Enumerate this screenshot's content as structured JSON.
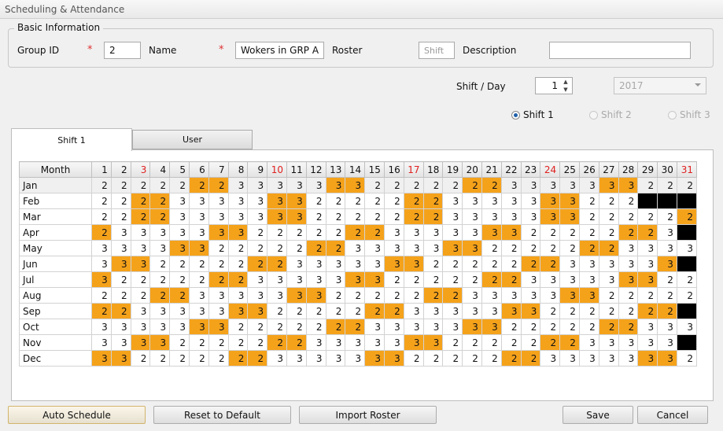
{
  "window": {
    "title": "Scheduling & Attendance"
  },
  "basic_info": {
    "legend": "Basic Information",
    "group_id_label": "Group ID",
    "required_mark": "*",
    "group_id_value": "2",
    "name_label": "Name",
    "name_value": "Wokers in GRP A",
    "roster_label": "Roster",
    "roster_placeholder": "Shift",
    "description_label": "Description",
    "description_value": ""
  },
  "shift_day": {
    "label": "Shift / Day",
    "value": "1",
    "year": "2017"
  },
  "shift_radios": [
    {
      "label": "Shift 1",
      "selected": true
    },
    {
      "label": "Shift 2",
      "selected": false
    },
    {
      "label": "Shift 3",
      "selected": false
    }
  ],
  "tabs": [
    {
      "label": "Shift 1"
    },
    {
      "label": "User"
    }
  ],
  "grid": {
    "month_header": "Month",
    "days": [
      "1",
      "2",
      "3",
      "4",
      "5",
      "6",
      "7",
      "8",
      "9",
      "10",
      "11",
      "12",
      "13",
      "14",
      "15",
      "16",
      "17",
      "18",
      "19",
      "20",
      "21",
      "22",
      "23",
      "24",
      "25",
      "26",
      "27",
      "28",
      "29",
      "30",
      "31"
    ],
    "red_days": [
      3,
      10,
      17,
      24,
      31
    ],
    "colors": {
      "highlight": "#f5a21b",
      "unavailable": "#000000"
    },
    "rows": [
      {
        "month": "Jan",
        "values": [
          "2",
          "2",
          "2",
          "2",
          "2",
          "2",
          "2",
          "3",
          "3",
          "3",
          "3",
          "3",
          "3",
          "3",
          "2",
          "2",
          "2",
          "2",
          "2",
          "2",
          "2",
          "3",
          "3",
          "3",
          "3",
          "3",
          "3",
          "3",
          "2",
          "2",
          "2"
        ],
        "highlight": [
          6,
          7,
          13,
          14,
          20,
          21,
          27,
          28
        ]
      },
      {
        "month": "Feb",
        "values": [
          "2",
          "2",
          "2",
          "2",
          "3",
          "3",
          "3",
          "3",
          "3",
          "3",
          "3",
          "2",
          "2",
          "2",
          "2",
          "2",
          "2",
          "2",
          "3",
          "3",
          "3",
          "3",
          "3",
          "3",
          "3",
          "2",
          "2",
          "2",
          "",
          "",
          ""
        ],
        "highlight": [
          3,
          4,
          10,
          11,
          17,
          18,
          24,
          25
        ],
        "blocked": [
          29,
          30,
          31
        ]
      },
      {
        "month": "Mar",
        "values": [
          "2",
          "2",
          "2",
          "2",
          "3",
          "3",
          "3",
          "3",
          "3",
          "3",
          "3",
          "2",
          "2",
          "2",
          "2",
          "2",
          "2",
          "2",
          "3",
          "3",
          "3",
          "3",
          "3",
          "3",
          "3",
          "2",
          "2",
          "2",
          "2",
          "2",
          "2"
        ],
        "highlight": [
          3,
          4,
          10,
          11,
          17,
          18,
          24,
          25,
          31
        ]
      },
      {
        "month": "Apr",
        "values": [
          "2",
          "3",
          "3",
          "3",
          "3",
          "3",
          "3",
          "3",
          "2",
          "2",
          "2",
          "2",
          "2",
          "2",
          "2",
          "3",
          "3",
          "3",
          "3",
          "3",
          "3",
          "3",
          "2",
          "2",
          "2",
          "2",
          "2",
          "2",
          "2",
          "3",
          ""
        ],
        "highlight": [
          1,
          7,
          8,
          14,
          15,
          21,
          22,
          28,
          29
        ],
        "blocked": [
          31
        ]
      },
      {
        "month": "May",
        "values": [
          "3",
          "3",
          "3",
          "3",
          "3",
          "3",
          "2",
          "2",
          "2",
          "2",
          "2",
          "2",
          "2",
          "3",
          "3",
          "3",
          "3",
          "3",
          "3",
          "3",
          "2",
          "2",
          "2",
          "2",
          "2",
          "2",
          "2",
          "3",
          "3",
          "3",
          "3"
        ],
        "highlight": [
          5,
          6,
          12,
          13,
          19,
          20,
          26,
          27
        ]
      },
      {
        "month": "Jun",
        "values": [
          "3",
          "3",
          "3",
          "2",
          "2",
          "2",
          "2",
          "2",
          "2",
          "2",
          "3",
          "3",
          "3",
          "3",
          "3",
          "3",
          "3",
          "2",
          "2",
          "2",
          "2",
          "2",
          "2",
          "2",
          "3",
          "3",
          "3",
          "3",
          "3",
          "3",
          ""
        ],
        "highlight": [
          2,
          3,
          9,
          10,
          16,
          17,
          23,
          24,
          30
        ],
        "blocked": [
          31
        ]
      },
      {
        "month": "Jul",
        "values": [
          "3",
          "2",
          "2",
          "2",
          "2",
          "2",
          "2",
          "2",
          "3",
          "3",
          "3",
          "3",
          "3",
          "3",
          "3",
          "2",
          "2",
          "2",
          "2",
          "2",
          "2",
          "2",
          "3",
          "3",
          "3",
          "3",
          "3",
          "3",
          "3",
          "2",
          "2"
        ],
        "highlight": [
          1,
          7,
          8,
          14,
          15,
          21,
          22,
          28,
          29
        ]
      },
      {
        "month": "Aug",
        "values": [
          "2",
          "2",
          "2",
          "2",
          "2",
          "3",
          "3",
          "3",
          "3",
          "3",
          "3",
          "3",
          "2",
          "2",
          "2",
          "2",
          "2",
          "2",
          "2",
          "3",
          "3",
          "3",
          "3",
          "3",
          "3",
          "3",
          "2",
          "2",
          "2",
          "2",
          "2"
        ],
        "highlight": [
          4,
          5,
          11,
          12,
          18,
          19,
          25,
          26
        ]
      },
      {
        "month": "Sep",
        "values": [
          "2",
          "2",
          "3",
          "3",
          "3",
          "3",
          "3",
          "3",
          "3",
          "2",
          "2",
          "2",
          "2",
          "2",
          "2",
          "2",
          "3",
          "3",
          "3",
          "3",
          "3",
          "3",
          "3",
          "2",
          "2",
          "2",
          "2",
          "2",
          "2",
          "2",
          ""
        ],
        "highlight": [
          1,
          2,
          8,
          9,
          15,
          16,
          22,
          23,
          29,
          30
        ],
        "blocked": [
          31
        ]
      },
      {
        "month": "Oct",
        "values": [
          "3",
          "3",
          "3",
          "3",
          "3",
          "3",
          "3",
          "2",
          "2",
          "2",
          "2",
          "2",
          "2",
          "2",
          "3",
          "3",
          "3",
          "3",
          "3",
          "3",
          "3",
          "2",
          "2",
          "2",
          "2",
          "2",
          "2",
          "2",
          "3",
          "3",
          "3"
        ],
        "highlight": [
          6,
          7,
          13,
          14,
          20,
          21,
          27,
          28
        ]
      },
      {
        "month": "Nov",
        "values": [
          "3",
          "3",
          "3",
          "3",
          "2",
          "2",
          "2",
          "2",
          "2",
          "2",
          "2",
          "3",
          "3",
          "3",
          "3",
          "3",
          "3",
          "3",
          "2",
          "2",
          "2",
          "2",
          "2",
          "2",
          "2",
          "3",
          "3",
          "3",
          "3",
          "3",
          ""
        ],
        "highlight": [
          3,
          4,
          10,
          11,
          17,
          18,
          24,
          25
        ],
        "blocked": [
          31
        ]
      },
      {
        "month": "Dec",
        "values": [
          "3",
          "3",
          "2",
          "2",
          "2",
          "2",
          "2",
          "2",
          "2",
          "3",
          "3",
          "3",
          "3",
          "3",
          "3",
          "3",
          "2",
          "2",
          "2",
          "2",
          "2",
          "2",
          "2",
          "3",
          "3",
          "3",
          "3",
          "3",
          "3",
          "3",
          "2"
        ],
        "highlight": [
          1,
          2,
          8,
          9,
          15,
          16,
          22,
          23,
          29,
          30
        ]
      }
    ]
  },
  "buttons": {
    "auto_schedule": "Auto Schedule",
    "reset_default": "Reset to Default",
    "import_roster": "Import Roster",
    "save": "Save",
    "cancel": "Cancel"
  }
}
